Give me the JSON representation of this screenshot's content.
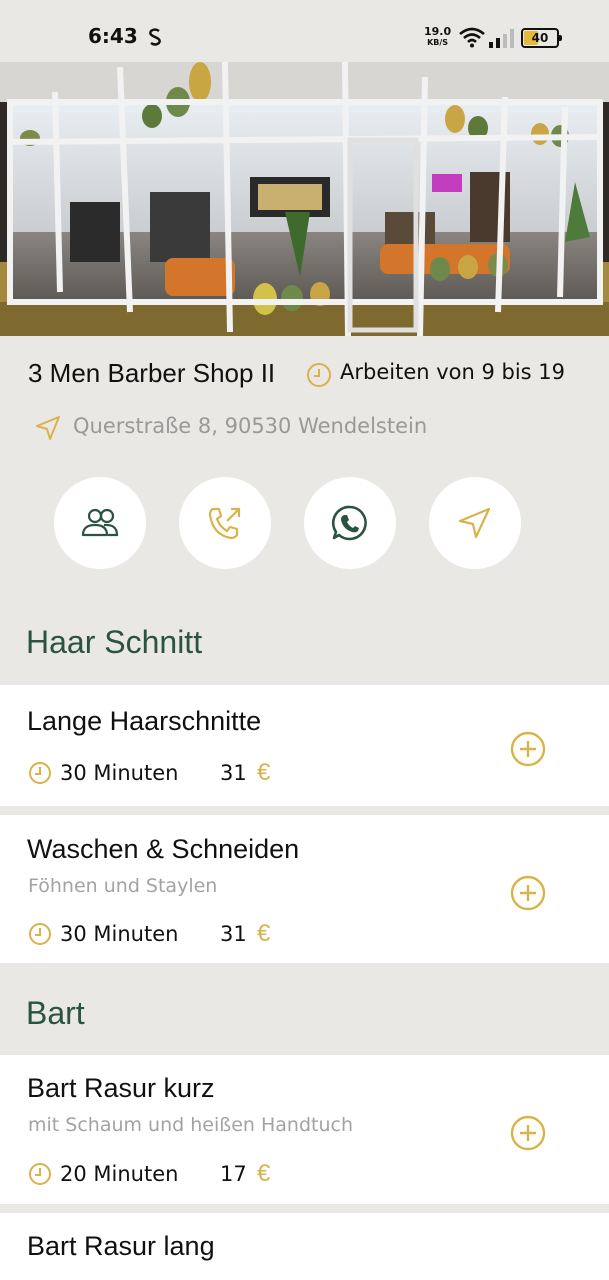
{
  "status_bar": {
    "time": "6:43",
    "net_speed": "19.0",
    "net_unit": "KB/S",
    "battery": "40"
  },
  "colors": {
    "accent": "#d9b24c",
    "section": "#2a5341",
    "background": "#eae8e5"
  },
  "shop": {
    "name": "3 Men Barber Shop II",
    "hours": "Arbeiten von 9 bis 19",
    "address": "Querstraße 8, 90530 Wendelstein"
  },
  "actions": [
    {
      "icon": "team-icon"
    },
    {
      "icon": "phone-icon"
    },
    {
      "icon": "whatsapp-icon"
    },
    {
      "icon": "navigation-icon"
    }
  ],
  "sections": [
    {
      "title": "Haar Schnitt",
      "services": [
        {
          "name": "Lange Haarschnitte",
          "description": "",
          "duration": "30 Minuten",
          "price": "31",
          "currency": "€"
        },
        {
          "name": "Waschen & Schneiden",
          "description": "Föhnen und Staylen",
          "duration": "30 Minuten",
          "price": "31",
          "currency": "€"
        }
      ]
    },
    {
      "title": "Bart",
      "services": [
        {
          "name": "Bart Rasur kurz",
          "description": "mit Schaum und heißen Handtuch",
          "duration": "20 Minuten",
          "price": "17",
          "currency": "€"
        },
        {
          "name": "Bart Rasur lang",
          "description": "",
          "duration": "",
          "price": "",
          "currency": ""
        }
      ]
    }
  ]
}
